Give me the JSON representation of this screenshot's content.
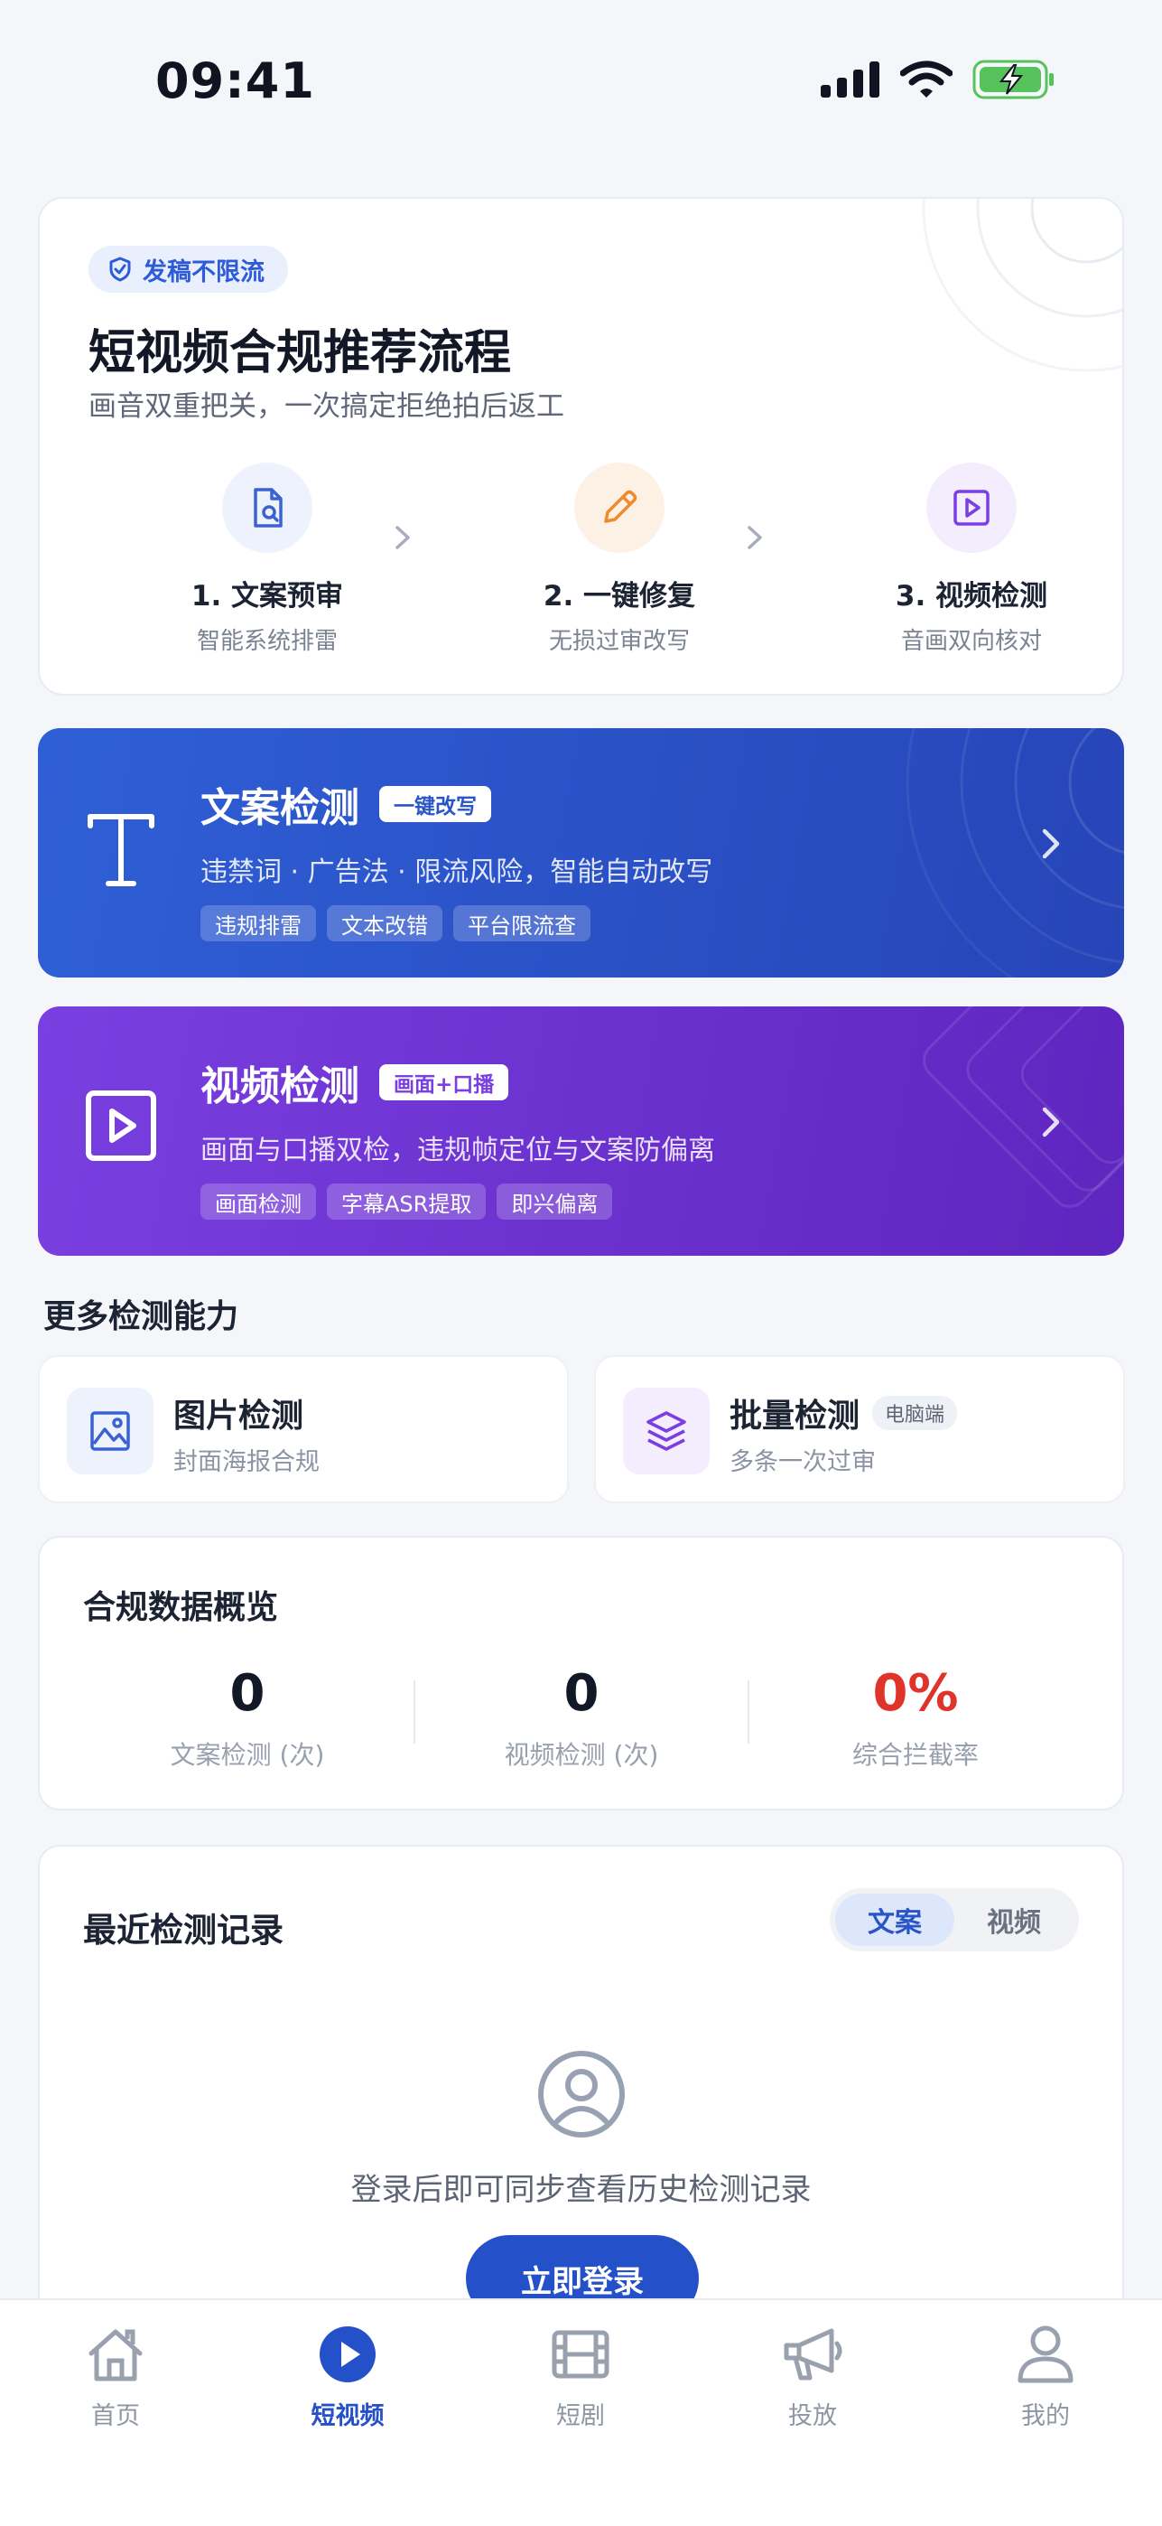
{
  "status_bar": {
    "time": "09:41"
  },
  "flow_card": {
    "badge": "发稿不限流",
    "title": "短视频合规推荐流程",
    "subtitle": "画音双重把关，一次搞定拒绝拍后返工",
    "steps": [
      {
        "name": "1. 文案预审",
        "desc": "智能系统排雷",
        "icon": "document-search-icon"
      },
      {
        "name": "2. 一键修复",
        "desc": "无损过审改写",
        "icon": "pencil-icon"
      },
      {
        "name": "3. 视频检测",
        "desc": "音画双向核对",
        "icon": "play-square-icon"
      }
    ]
  },
  "text_check": {
    "title": "文案检测",
    "tag": "一键改写",
    "desc": "违禁词 · 广告法 · 限流风险，智能自动改写",
    "chips": [
      "违规排雷",
      "文本改错",
      "平台限流查"
    ],
    "color": "#2f5fd6"
  },
  "video_check": {
    "title": "视频检测",
    "tag": "画面+口播",
    "desc": "画面与口播双检，违规帧定位与文案防偏离",
    "chips": [
      "画面检测",
      "字幕ASR提取",
      "即兴偏离"
    ],
    "color": "#7a3fe0"
  },
  "more": {
    "heading": "更多检测能力",
    "items": [
      {
        "title": "图片检测",
        "desc": "封面海报合规",
        "tag": ""
      },
      {
        "title": "批量检测",
        "desc": "多条一次过审",
        "tag": "电脑端"
      }
    ]
  },
  "stats": {
    "title": "合规数据概览",
    "items": [
      {
        "value": "0",
        "label": "文案检测 (次)"
      },
      {
        "value": "0",
        "label": "视频检测 (次)"
      },
      {
        "value": "0%",
        "label": "综合拦截率"
      }
    ],
    "danger_color": "#e0342b"
  },
  "records": {
    "title": "最近检测记录",
    "tabs": [
      "文案",
      "视频"
    ],
    "active_tab": "文案",
    "empty_text": "登录后即可同步查看历史检测记录",
    "login_label": "立即登录"
  },
  "tab_bar": {
    "items": [
      {
        "label": "首页",
        "icon": "home-icon"
      },
      {
        "label": "短视频",
        "icon": "play-circle-icon"
      },
      {
        "label": "短剧",
        "icon": "film-icon"
      },
      {
        "label": "投放",
        "icon": "megaphone-icon"
      },
      {
        "label": "我的",
        "icon": "user-icon"
      }
    ],
    "active": "短视频",
    "accent": "#2450c9"
  }
}
